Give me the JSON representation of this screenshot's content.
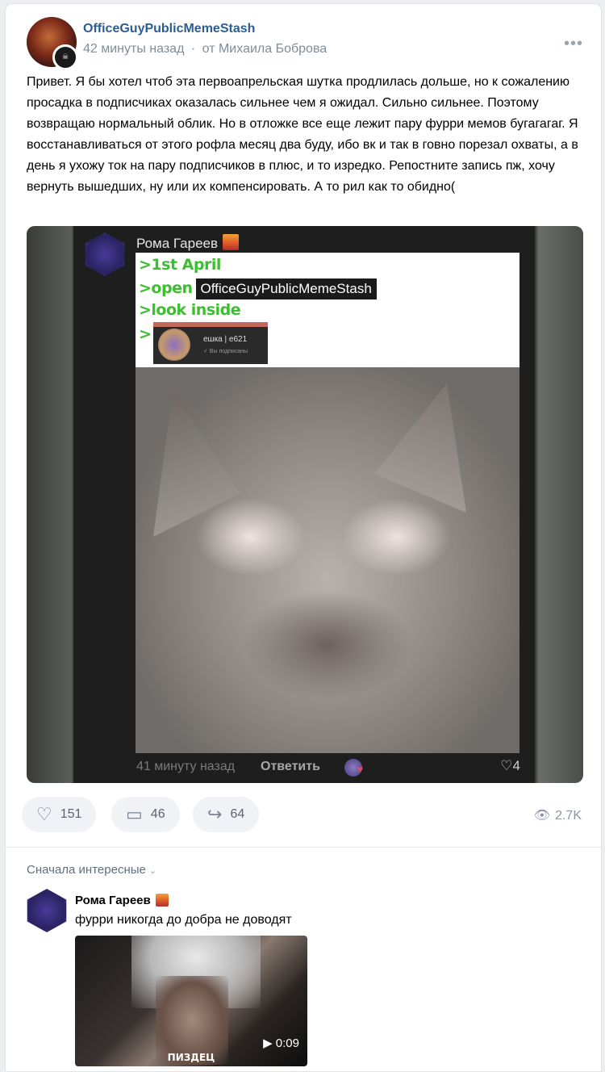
{
  "post": {
    "group_name": "OfficeGuyPublicMemeStash",
    "time": "42 минуты назад",
    "separator": "·",
    "author": "от Михаила Боброва",
    "more_icon": "more-horizontal-icon",
    "text": "Привет. Я бы хотел чтоб эта первоапрельская шутка продлилась дольше, но к сожалению просадка в подписчиках оказалась сильнее чем я ожидал. Сильно сильнее. Поэтому возвращаю нормальный облик. Но в отложке все еще лежит пару фурри мемов бугагагаг. Я восстанавливаться от этого рофла месяц два буду, ибо вк и так в говно порезал охваты, а в день я ухожу ток на пару подписчиков в плюс, и то изредко. Репостните запись пж, хочу вернуть вышедших, ну или их компенсировать. А то рил как то обидно("
  },
  "screenshot": {
    "commenter": "Рома Гареев",
    "meme_lines": [
      ">1st April",
      ">open",
      ">look inside",
      ">"
    ],
    "meme_tag": "OfficeGuyPublicMemeStash",
    "mini_card_name": "ешка | e621",
    "mini_card_sub": "✓ Вы подписаны",
    "time": "41 минуту назад",
    "reply": "Ответить",
    "likes": "4"
  },
  "actions": {
    "likes": "151",
    "comments": "46",
    "reposts": "64",
    "views": "2.7K"
  },
  "comments": {
    "sort_label": "Сначала интересные",
    "items": [
      {
        "author": "Рома Гареев",
        "text": "фурри никогда до добра не доводят",
        "video_caption": "ПИЗДЕЦ",
        "video_duration": "0:09"
      }
    ]
  }
}
